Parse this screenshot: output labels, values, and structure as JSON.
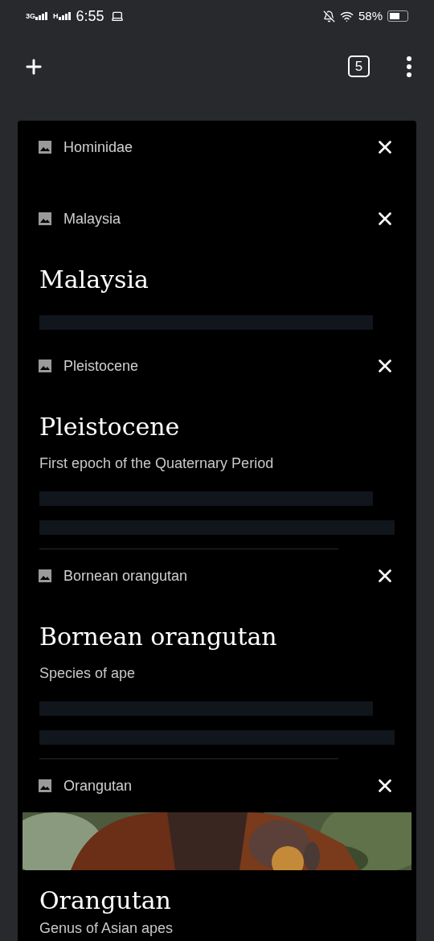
{
  "status_bar": {
    "network_1": "3G",
    "network_2": "H",
    "time": "6:55",
    "battery": "58%"
  },
  "toolbar": {
    "tab_count": "5"
  },
  "tabs": [
    {
      "title": "Hominidae",
      "preview": {
        "kind": "none"
      }
    },
    {
      "title": "Malaysia",
      "preview": {
        "kind": "article",
        "heading": "Malaysia"
      }
    },
    {
      "title": "Pleistocene",
      "preview": {
        "kind": "article",
        "heading": "Pleistocene",
        "subtitle": "First epoch of the Quaternary Period"
      }
    },
    {
      "title": "Bornean orangutan",
      "preview": {
        "kind": "article",
        "heading": "Bornean orangutan",
        "subtitle": "Species of ape"
      }
    },
    {
      "title": "Orangutan",
      "preview": {
        "kind": "image_article",
        "heading": "Orangutan",
        "subtitle": "Genus of Asian apes"
      }
    }
  ]
}
